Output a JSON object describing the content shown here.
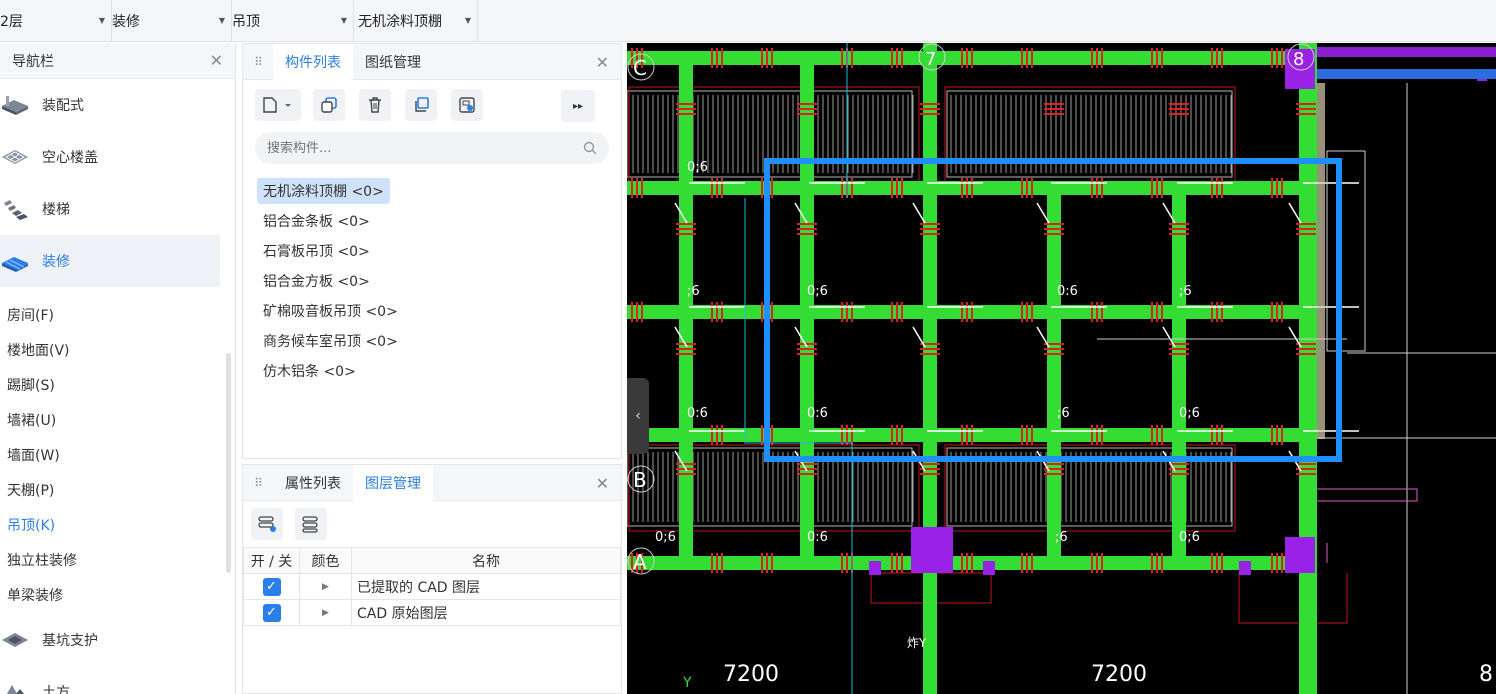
{
  "topbar": {
    "floor": "2层",
    "category": "装修",
    "type": "吊顶",
    "component": "无机涂料顶棚"
  },
  "nav": {
    "title": "导航栏",
    "categories_top": [
      {
        "label": "装配式",
        "icon": "prefab-icon"
      },
      {
        "label": "空心楼盖",
        "icon": "hollow-floor-icon"
      },
      {
        "label": "楼梯",
        "icon": "stairs-icon"
      },
      {
        "label": "装修",
        "icon": "decoration-icon",
        "active": true
      }
    ],
    "subitems": [
      "房间(F)",
      "楼地面(V)",
      "踢脚(S)",
      "墙裙(U)",
      "墙面(W)",
      "天棚(P)",
      "吊顶(K)",
      "独立柱装修",
      "单梁装修"
    ],
    "active_subitem": "吊顶(K)",
    "categories_bottom": [
      {
        "label": "基坑支护",
        "icon": "pit-support-icon"
      },
      {
        "label": "土方",
        "icon": "earthwork-icon"
      }
    ]
  },
  "component_panel": {
    "tabs": [
      "构件列表",
      "图纸管理"
    ],
    "active_tab": "构件列表",
    "search_placeholder": "搜索构件...",
    "items": [
      "无机涂料顶棚 <0>",
      "铝合金条板 <0>",
      "石膏板吊顶 <0>",
      "铝合金方板 <0>",
      "矿棉吸音板吊顶 <0>",
      "商务候车室吊顶 <0>",
      "仿木铝条 <0>"
    ],
    "selected": "无机涂料顶棚 <0>"
  },
  "layer_panel": {
    "tabs": [
      "属性列表",
      "图层管理"
    ],
    "active_tab": "图层管理",
    "headers": [
      "开 / 关",
      "颜色",
      "名称"
    ],
    "rows": [
      {
        "on": true,
        "name": "已提取的 CAD 图层"
      },
      {
        "on": true,
        "name": "CAD 原始图层"
      }
    ]
  },
  "cad": {
    "axis_labels": [
      "C",
      "B",
      "A",
      "7",
      "8"
    ],
    "dims": [
      "7200",
      "7200",
      "8"
    ],
    "small_labels": [
      "0;6",
      "0:6",
      ";6",
      "炸Y"
    ],
    "colors": {
      "grid_green": "#33dd33",
      "beam_red": "#e02020",
      "selection_blue": "#1e8fff",
      "column_purple": "#9a22e6"
    }
  }
}
